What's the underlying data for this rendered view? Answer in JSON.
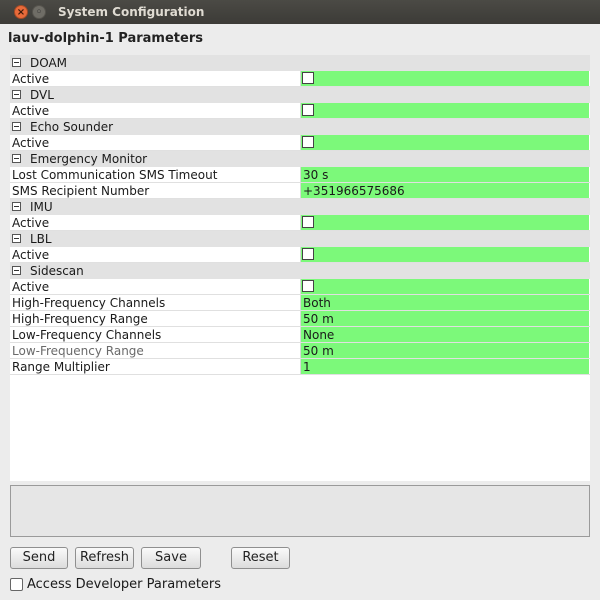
{
  "window": {
    "title": "System Configuration",
    "close_icon": "×",
    "maximize_icon": "◦"
  },
  "header": {
    "title": "lauv-dolphin-1 Parameters"
  },
  "sections": [
    {
      "name": "DOAM",
      "params": [
        {
          "label": "Active",
          "type": "checkbox",
          "checked": false
        }
      ]
    },
    {
      "name": "DVL",
      "params": [
        {
          "label": "Active",
          "type": "checkbox",
          "checked": false
        }
      ]
    },
    {
      "name": "Echo Sounder",
      "params": [
        {
          "label": "Active",
          "type": "checkbox",
          "checked": false
        }
      ]
    },
    {
      "name": "Emergency Monitor",
      "params": [
        {
          "label": "Lost Communication SMS Timeout",
          "type": "text",
          "value": "30 s"
        },
        {
          "label": "SMS Recipient Number",
          "type": "text",
          "value": "+351966575686"
        }
      ]
    },
    {
      "name": "IMU",
      "params": [
        {
          "label": "Active",
          "type": "checkbox",
          "checked": false
        }
      ]
    },
    {
      "name": "LBL",
      "params": [
        {
          "label": "Active",
          "type": "checkbox",
          "checked": false
        }
      ]
    },
    {
      "name": "Sidescan",
      "params": [
        {
          "label": "Active",
          "type": "checkbox",
          "checked": false
        },
        {
          "label": "High-Frequency Channels",
          "type": "text",
          "value": "Both"
        },
        {
          "label": "High-Frequency Range",
          "type": "text",
          "value": "50 m"
        },
        {
          "label": "Low-Frequency Channels",
          "type": "text",
          "value": "None"
        },
        {
          "label": "Low-Frequency Range",
          "type": "text",
          "value": "50 m",
          "dim": true
        },
        {
          "label": "Range Multiplier",
          "type": "text",
          "value": "1"
        }
      ]
    }
  ],
  "buttons": {
    "send": "Send",
    "refresh": "Refresh",
    "save": "Save",
    "reset": "Reset"
  },
  "developer": {
    "label": "Access Developer Parameters",
    "checked": false
  },
  "colors": {
    "value_bg": "#7cf97a",
    "section_bg": "#e2e2e2"
  }
}
